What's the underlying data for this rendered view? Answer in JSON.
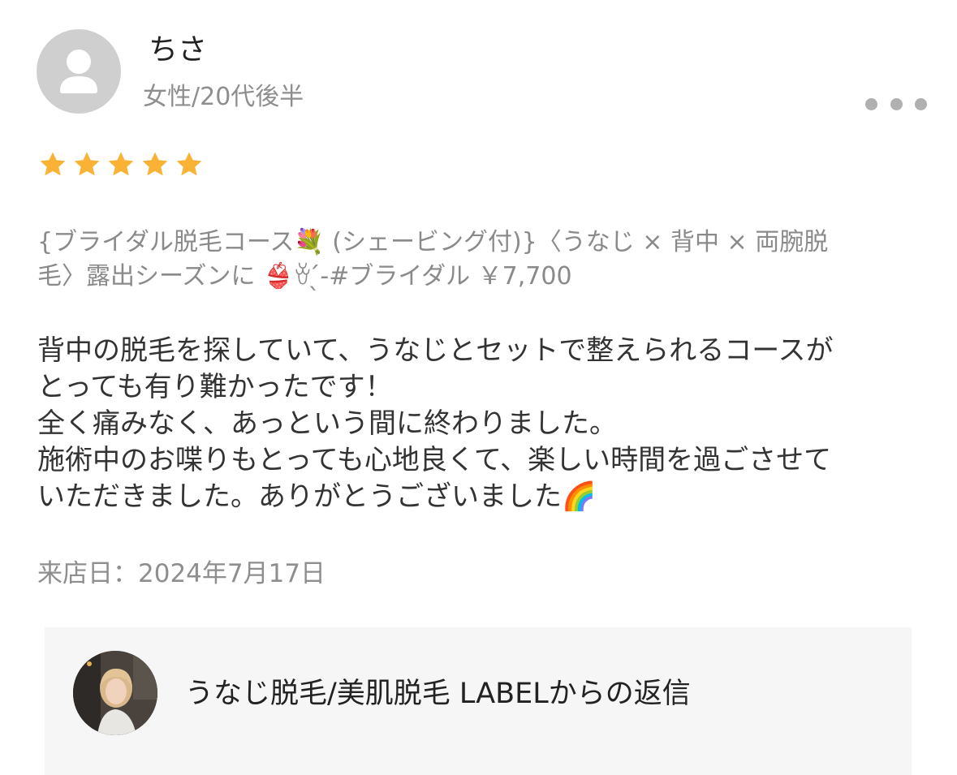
{
  "reviewer": {
    "name": "ちさ",
    "meta": "女性/20代後半",
    "avatar_icon": "user-silhouette-icon"
  },
  "menu": {
    "more_icon": "more-dots-icon"
  },
  "rating": {
    "stars": 5,
    "max": 5,
    "color": "#f9b233"
  },
  "review": {
    "course": "{ブライダル脱毛コース💐 (シェービング付)}〈うなじ × 背中 × 両腕脱\n毛〉露出シーズンに 👙ꈊ ̖́-#ブライダル ￥7,700",
    "body": "背中の脱毛を探していて、うなじとセットで整えられるコースが\nとっても有り難かったです！\n全く痛みなく、あっという間に終わりました。\n施術中のお喋りもとっても心地良くて、楽しい時間を過ごさせて\nいただきました。ありがとうございました🌈",
    "visit_date": "来店日：2024年7月17日"
  },
  "reply": {
    "title": "うなじ脱毛/美肌脱毛 LABELからの返信",
    "avatar_icon": "shop-staff-photo"
  },
  "colors": {
    "reply_background": "#f6f6f6",
    "muted_text": "#8e8e8e",
    "avatar_placeholder": "#cfcfcf"
  }
}
